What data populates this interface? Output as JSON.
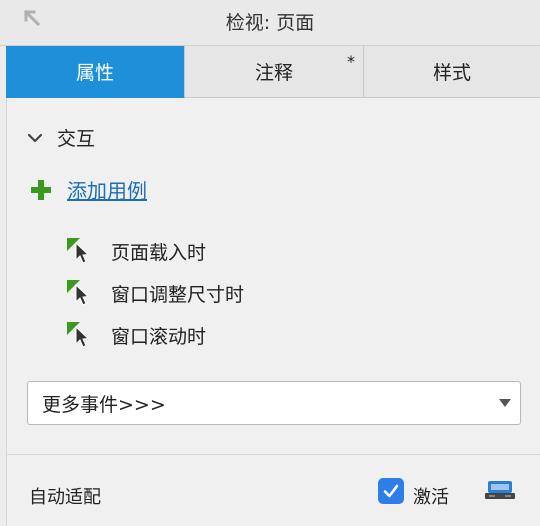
{
  "titlebar": {
    "title": "检视: 页面",
    "collapse_icon": "collapse-arrow-icon"
  },
  "tabs": [
    {
      "label": "属性",
      "active": true,
      "modified": false
    },
    {
      "label": "注释",
      "active": false,
      "modified": true,
      "modified_marker": "*"
    },
    {
      "label": "样式",
      "active": false,
      "modified": false
    }
  ],
  "interactions": {
    "section_label": "交互",
    "expanded": true,
    "add_case_label": "添加用例",
    "events": [
      {
        "label": "页面载入时",
        "icon": "event-cursor-icon"
      },
      {
        "label": "窗口调整尺寸时",
        "icon": "event-cursor-icon"
      },
      {
        "label": "窗口滚动时",
        "icon": "event-cursor-icon"
      }
    ],
    "more_events_label": "更多事件>>>"
  },
  "adaptive": {
    "label": "自动适配",
    "activate_label": "激活",
    "activate_checked": true,
    "settings_icon": "adaptive-view-icon"
  },
  "colors": {
    "accent": "#1e8fd9",
    "link": "#1d6fb3",
    "add_green": "#3a9a1e",
    "checkbox_blue": "#2d7ee8"
  }
}
